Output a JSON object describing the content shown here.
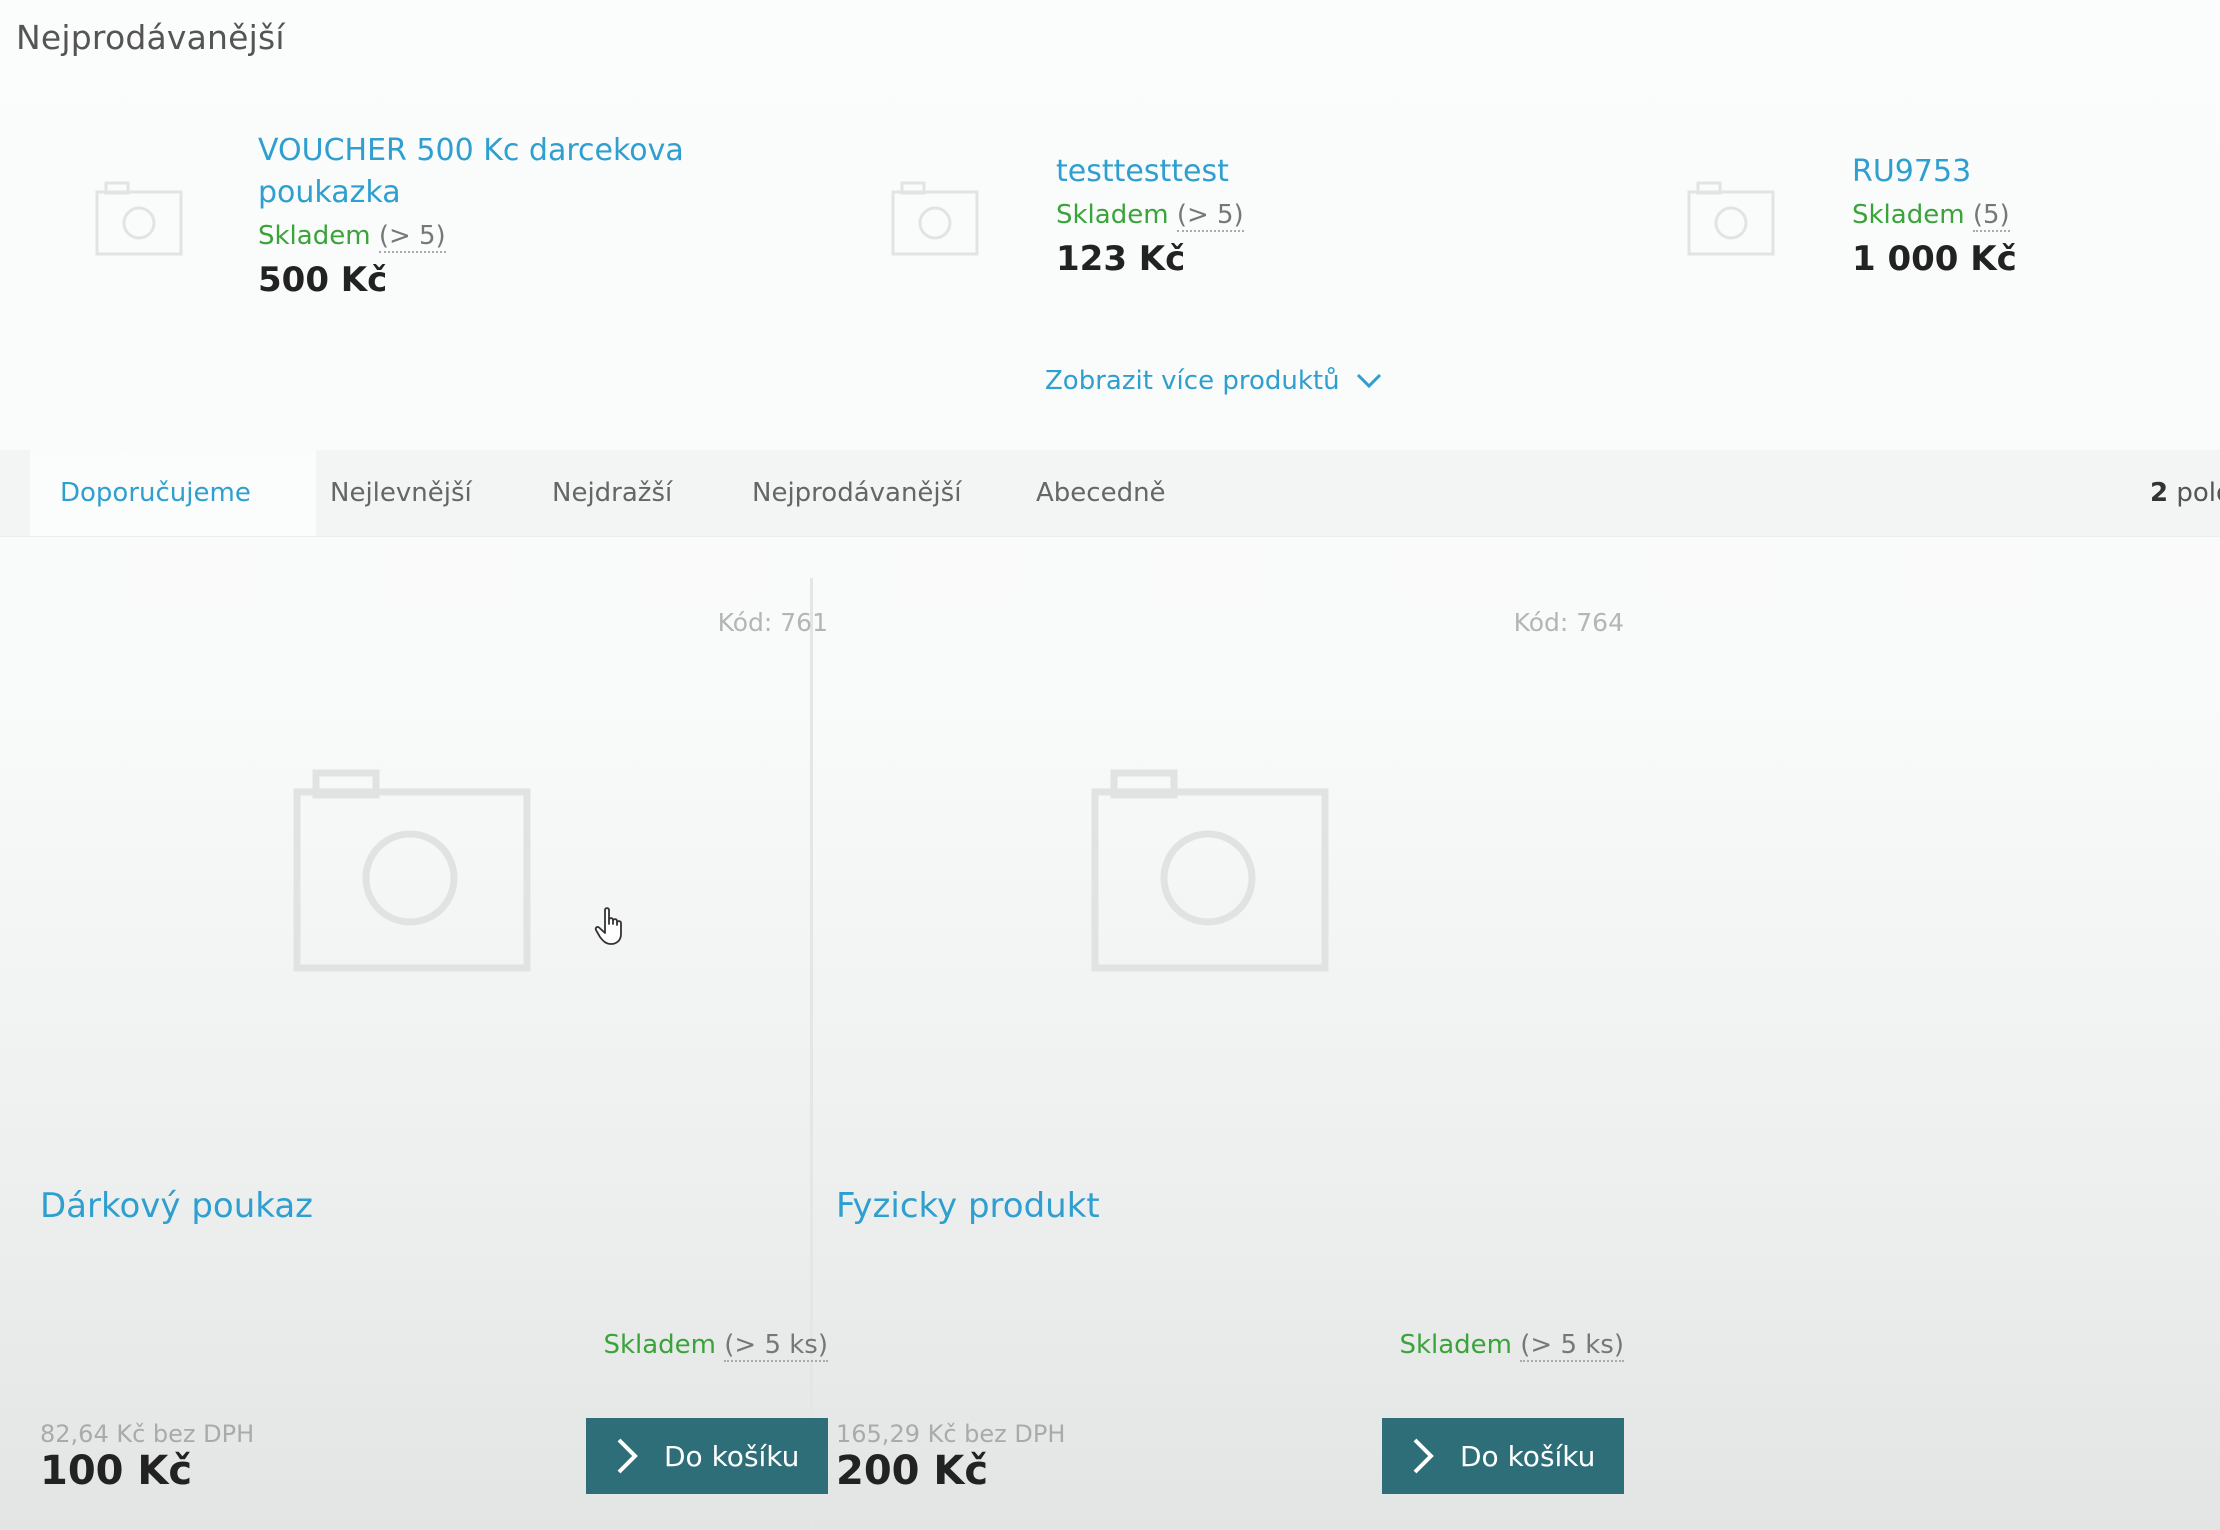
{
  "section_title": "Nejprodávanější",
  "bestsellers": [
    {
      "name": "VOUCHER 500 Kc darcekova poukazka",
      "stock_label": "Skladem",
      "stock_count": "(> 5)",
      "price": "500 Kč",
      "thumb_icon": "camera-icon"
    },
    {
      "name": "testtesttest",
      "stock_label": "Skladem",
      "stock_count": "(> 5)",
      "price": "123 Kč",
      "thumb_icon": "camera-icon"
    },
    {
      "name": "RU9753",
      "stock_label": "Skladem",
      "stock_count": "(5)",
      "price": "1 000 Kč",
      "thumb_icon": "camera-icon"
    }
  ],
  "more_products": {
    "label": "Zobrazit více produktů",
    "icon": "chevron-down-icon"
  },
  "sort_tabs": [
    {
      "label": "Doporučujeme",
      "active": true
    },
    {
      "label": "Nejlevnější",
      "active": false
    },
    {
      "label": "Nejdražší",
      "active": false
    },
    {
      "label": "Nejprodávanější",
      "active": false
    },
    {
      "label": "Abecedně",
      "active": false
    }
  ],
  "item_count": {
    "number": "2",
    "suffix": "polo"
  },
  "products": [
    {
      "code": "Kód: 761",
      "name": "Dárkový poukaz",
      "stock_label": "Skladem",
      "stock_count": "(> 5 ks)",
      "price_net": "82,64 Kč bez DPH",
      "price": "100 Kč",
      "button_label": "Do košíku",
      "image_icon": "camera-icon"
    },
    {
      "code": "Kód: 764",
      "name": "Fyzicky produkt",
      "stock_label": "Skladem",
      "stock_count": "(> 5 ks)",
      "price_net": "165,29 Kč bez DPH",
      "price": "200 Kč",
      "button_label": "Do košíku",
      "image_icon": "camera-icon"
    }
  ],
  "colors": {
    "link": "#2f9fd0",
    "in_stock": "#3aa33a",
    "cart_button": "#2d6e78",
    "price": "#222222"
  }
}
